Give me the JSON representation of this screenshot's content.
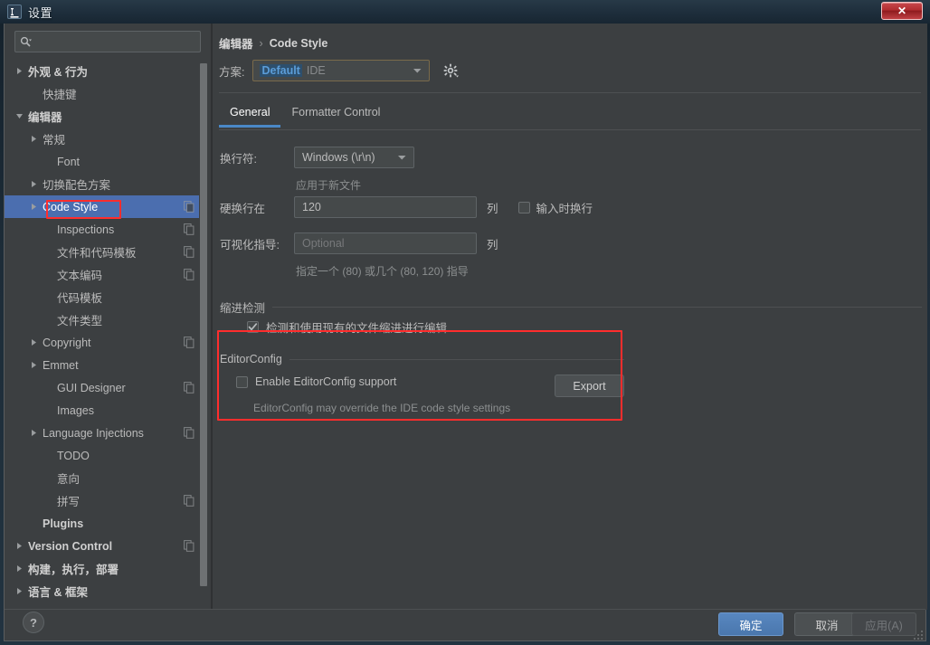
{
  "window": {
    "title": "设置",
    "app_icon": "intellij-idea-icon",
    "close_label": "✕"
  },
  "sidebar": {
    "search": {
      "value": "",
      "placeholder": "",
      "icon": "search-icon"
    },
    "items": [
      {
        "label": "外观 & 行为",
        "indent": 0,
        "arrow": "collapsed",
        "bold": true,
        "copy": false,
        "selected": false
      },
      {
        "label": "快捷键",
        "indent": 1,
        "arrow": "none",
        "bold": false,
        "copy": false,
        "selected": false
      },
      {
        "label": "编辑器",
        "indent": 0,
        "arrow": "expanded",
        "bold": true,
        "copy": false,
        "selected": false
      },
      {
        "label": "常规",
        "indent": 1,
        "arrow": "collapsed",
        "bold": false,
        "copy": false,
        "selected": false
      },
      {
        "label": "Font",
        "indent": 2,
        "arrow": "none",
        "bold": false,
        "copy": false,
        "selected": false
      },
      {
        "label": "切换配色方案",
        "indent": 1,
        "arrow": "collapsed",
        "bold": false,
        "copy": false,
        "selected": false
      },
      {
        "label": "Code Style",
        "indent": 1,
        "arrow": "collapsed",
        "bold": false,
        "copy": true,
        "selected": true
      },
      {
        "label": "Inspections",
        "indent": 2,
        "arrow": "none",
        "bold": false,
        "copy": true,
        "selected": false
      },
      {
        "label": "文件和代码模板",
        "indent": 2,
        "arrow": "none",
        "bold": false,
        "copy": true,
        "selected": false
      },
      {
        "label": "文本编码",
        "indent": 2,
        "arrow": "none",
        "bold": false,
        "copy": true,
        "selected": false
      },
      {
        "label": "代码模板",
        "indent": 2,
        "arrow": "none",
        "bold": false,
        "copy": false,
        "selected": false
      },
      {
        "label": "文件类型",
        "indent": 2,
        "arrow": "none",
        "bold": false,
        "copy": false,
        "selected": false
      },
      {
        "label": "Copyright",
        "indent": 1,
        "arrow": "collapsed",
        "bold": false,
        "copy": true,
        "selected": false
      },
      {
        "label": "Emmet",
        "indent": 1,
        "arrow": "collapsed",
        "bold": false,
        "copy": false,
        "selected": false
      },
      {
        "label": "GUI Designer",
        "indent": 2,
        "arrow": "none",
        "bold": false,
        "copy": true,
        "selected": false
      },
      {
        "label": "Images",
        "indent": 2,
        "arrow": "none",
        "bold": false,
        "copy": false,
        "selected": false
      },
      {
        "label": "Language Injections",
        "indent": 1,
        "arrow": "collapsed",
        "bold": false,
        "copy": true,
        "selected": false
      },
      {
        "label": "TODO",
        "indent": 2,
        "arrow": "none",
        "bold": false,
        "copy": false,
        "selected": false
      },
      {
        "label": "意向",
        "indent": 2,
        "arrow": "none",
        "bold": false,
        "copy": false,
        "selected": false
      },
      {
        "label": "拼写",
        "indent": 2,
        "arrow": "none",
        "bold": false,
        "copy": true,
        "selected": false
      },
      {
        "label": "Plugins",
        "indent": 1,
        "arrow": "none",
        "bold": true,
        "copy": false,
        "selected": false
      },
      {
        "label": "Version Control",
        "indent": 0,
        "arrow": "collapsed",
        "bold": true,
        "copy": true,
        "selected": false
      },
      {
        "label": "构建，执行，部署",
        "indent": 0,
        "arrow": "collapsed",
        "bold": true,
        "copy": false,
        "selected": false
      },
      {
        "label": "语言 & 框架",
        "indent": 0,
        "arrow": "collapsed",
        "bold": true,
        "copy": false,
        "selected": false
      }
    ]
  },
  "content": {
    "breadcrumb": {
      "parent": "编辑器",
      "separator": "›",
      "current": "Code Style"
    },
    "scheme": {
      "label": "方案:",
      "value": "Default",
      "scope": "IDE",
      "gear_icon": "gear-icon"
    },
    "tabs": [
      {
        "label": "General",
        "active": true
      },
      {
        "label": "Formatter Control",
        "active": false
      }
    ],
    "general": {
      "line_separator": {
        "label": "换行符:",
        "value": "Windows (\\r\\n)",
        "hint": "应用于新文件"
      },
      "hard_wrap": {
        "label": "硬换行在",
        "value": "120",
        "unit": "列",
        "wrap_on_typing": {
          "label": "输入时换行",
          "checked": false
        }
      },
      "visual_guides": {
        "label": "可视化指导:",
        "placeholder": "Optional",
        "value": "",
        "unit": "列",
        "hint": "指定一个 (80) 或几个 (80, 120) 指导"
      },
      "indent_detection": {
        "title": "缩进检测",
        "checkbox": {
          "label": "检测和使用现有的文件缩进进行编辑",
          "checked": true
        }
      },
      "editorconfig": {
        "title": "EditorConfig",
        "checkbox": {
          "label": "Enable EditorConfig support",
          "checked": false
        },
        "export_label": "Export",
        "note": "EditorConfig may override the IDE code style settings"
      }
    }
  },
  "footer": {
    "help_label": "?",
    "ok_label": "确定",
    "cancel_label": "取消",
    "apply_label": "应用(A)"
  },
  "colors": {
    "panel_bg": "#3c3f41",
    "selection_blue": "#4b6eaf",
    "accent_blue": "#4a88c7",
    "annotation_red": "#ff2d2d",
    "text": "#bbbbbb"
  }
}
